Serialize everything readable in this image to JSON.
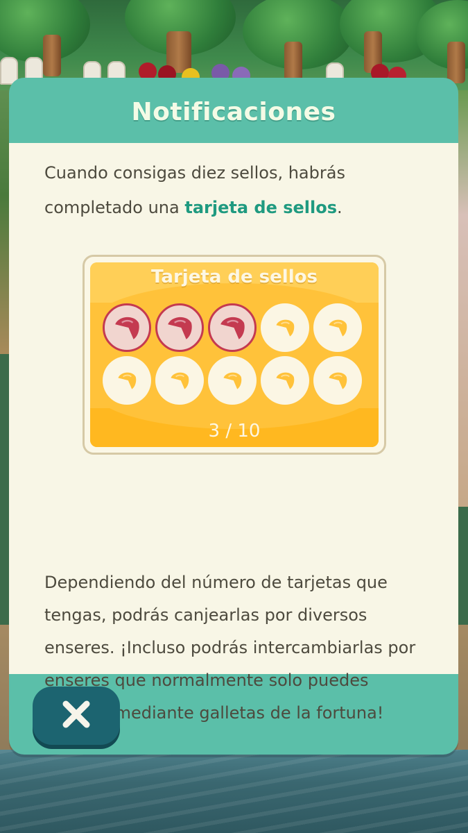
{
  "dialog": {
    "title": "Notificaciones",
    "intro_before": "Cuando consigas diez sellos, habrás completado una ",
    "intro_highlight": "tarjeta de sellos",
    "intro_after": ".",
    "description": "Dependiendo del número de tarjetas que tengas, podrás canjearlas por diversos enseres. ¡Incluso podrás intercambiarlas por enseres que normalmente solo puedes obtener mediante galletas de la fortuna!",
    "close_icon": "close-icon"
  },
  "stamp_card": {
    "title": "Tarjeta de sellos",
    "count_label": "3 / 10",
    "collected": 3,
    "total": 10,
    "stamp_icon": "stamp-icon"
  },
  "colors": {
    "header": "#5bbfa9",
    "body": "#f8f6e6",
    "highlight_text": "#1f9a80",
    "card": "#ffc23a",
    "stamp_filled": "#c43a50",
    "stamp_empty_mark": "#ffc23a",
    "close_button": "#1c6470"
  }
}
